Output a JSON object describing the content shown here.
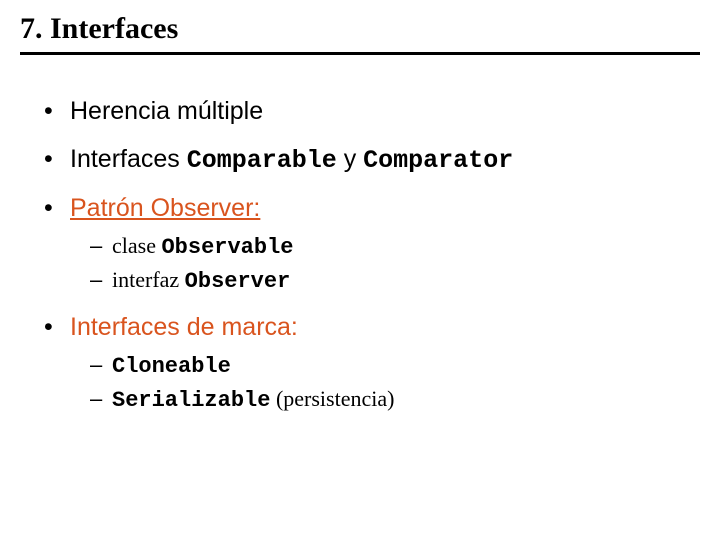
{
  "title": "7. Interfaces",
  "bullets": {
    "b1": "Herencia múltiple",
    "b2_pre": "Interfaces ",
    "b2_code1": "Comparable",
    "b2_mid": " y ",
    "b2_code2": "Comparator",
    "b3": "Patrón Observer:",
    "b3_s1_pre": "clase ",
    "b3_s1_code": "Observable",
    "b3_s2_pre": "interfaz ",
    "b3_s2_code": "Observer",
    "b4": "Interfaces de marca:",
    "b4_s1_code": "Cloneable",
    "b4_s2_code": "Serializable",
    "b4_s2_post": " (persistencia)"
  }
}
